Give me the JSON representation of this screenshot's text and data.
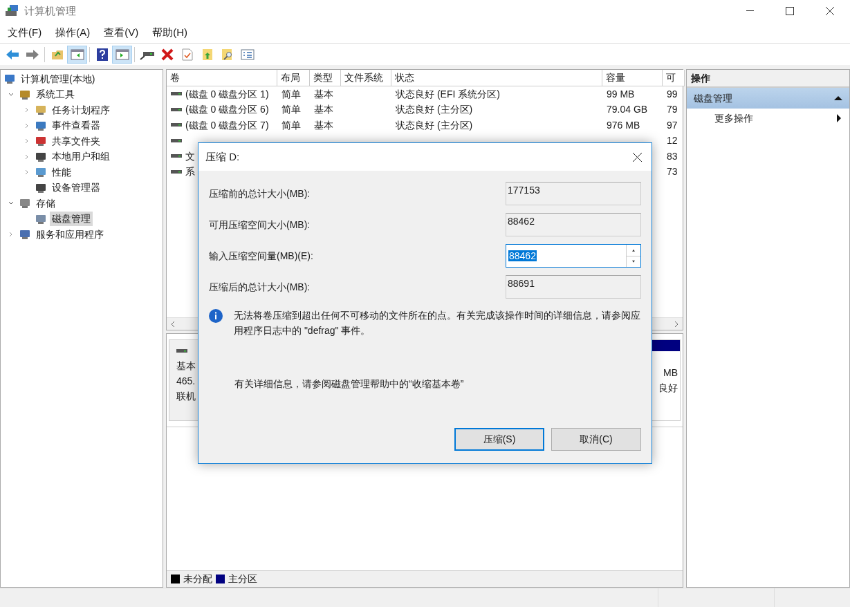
{
  "window": {
    "title": "计算机管理"
  },
  "menu": [
    "文件(F)",
    "操作(A)",
    "查看(V)",
    "帮助(H)"
  ],
  "toolbar": [
    [
      {
        "kind": "back",
        "selected": false
      },
      {
        "kind": "forward",
        "selected": false
      }
    ],
    [
      {
        "kind": "up",
        "selected": false
      },
      {
        "kind": "tree",
        "selected": true
      }
    ],
    [
      {
        "kind": "help",
        "selected": false
      },
      {
        "kind": "pane",
        "selected": true
      }
    ],
    [
      {
        "kind": "drive",
        "selected": false
      },
      {
        "kind": "delete",
        "selected": false
      },
      {
        "kind": "props",
        "selected": false
      },
      {
        "kind": "export",
        "selected": false
      },
      {
        "kind": "find",
        "selected": false
      },
      {
        "kind": "list",
        "selected": false
      }
    ]
  ],
  "tree": [
    {
      "label": "计算机管理(本地)",
      "selected": false,
      "children": [
        {
          "label": "系统工具",
          "expanded": true,
          "selected": false,
          "children": [
            {
              "label": "任务计划程序",
              "expanded": false,
              "selected": false
            },
            {
              "label": "事件查看器",
              "expanded": false,
              "selected": false
            },
            {
              "label": "共享文件夹",
              "expanded": false,
              "selected": false
            },
            {
              "label": "本地用户和组",
              "expanded": false,
              "selected": false
            },
            {
              "label": "性能",
              "expanded": false,
              "selected": false
            },
            {
              "label": "设备管理器",
              "selected": false
            }
          ]
        },
        {
          "label": "存储",
          "expanded": true,
          "selected": false,
          "children": [
            {
              "label": "磁盘管理",
              "selected": true
            }
          ]
        },
        {
          "label": "服务和应用程序",
          "expanded": false,
          "selected": false
        }
      ]
    }
  ],
  "table": {
    "columns": [
      "卷",
      "布局",
      "类型",
      "文件系统",
      "状态",
      "容量",
      "可"
    ],
    "rows": [
      {
        "volume": "(磁盘 0 磁盘分区 1)",
        "layout": "简单",
        "type": "基本",
        "status": "状态良好 (EFI 系统分区)",
        "capacity": "99 MB",
        "column_7": "99"
      },
      {
        "volume": "(磁盘 0 磁盘分区 6)",
        "layout": "简单",
        "type": "基本",
        "status": "状态良好 (主分区)",
        "capacity": "79.04 GB",
        "column_7": "79"
      },
      {
        "volume": "(磁盘 0 磁盘分区 7)",
        "layout": "简单",
        "type": "基本",
        "status": "状态良好 (主分区)",
        "capacity": "976 MB",
        "column_7": "97"
      },
      {
        "column_7": "12"
      },
      {
        "volume": "文",
        "column_7": "83"
      },
      {
        "volume": "系",
        "column_7": "73"
      }
    ]
  },
  "disk": {
    "lines": [
      "基本",
      "465.",
      "联机"
    ],
    "partition": {
      "lines": [
        "MB",
        "良好"
      ]
    }
  },
  "legend": [
    {
      "label": "未分配",
      "color": "#000000"
    },
    {
      "label": "主分区",
      "color": "#000080"
    }
  ],
  "actions": {
    "title": "操作",
    "section": {
      "label": "磁盘管理",
      "expanded": true
    },
    "items": [
      "更多操作"
    ]
  },
  "dialog": {
    "title": "压缩 D:",
    "fields": [
      {
        "kind": "readonly",
        "label": "压缩前的总计大小(MB):",
        "value": "177153"
      },
      {
        "kind": "readonly",
        "label": "可用压缩空间大小(MB):",
        "value": "88462"
      },
      {
        "kind": "spin",
        "label": "输入压缩空间量(MB)(E):",
        "value": "88462"
      },
      {
        "kind": "readonly",
        "label": "压缩后的总计大小(MB):",
        "value": "88691"
      }
    ],
    "info": "无法将卷压缩到超出任何不可移动的文件所在的点。有关完成该操作时间的详细信息，请参阅应用程序日志中的 \"defrag\" 事件。",
    "help": "有关详细信息，请参阅磁盘管理帮助中的“收缩基本卷”",
    "buttons": [
      {
        "label": "压缩(S)",
        "default": true
      },
      {
        "label": "取消(C)",
        "default": false
      }
    ]
  }
}
